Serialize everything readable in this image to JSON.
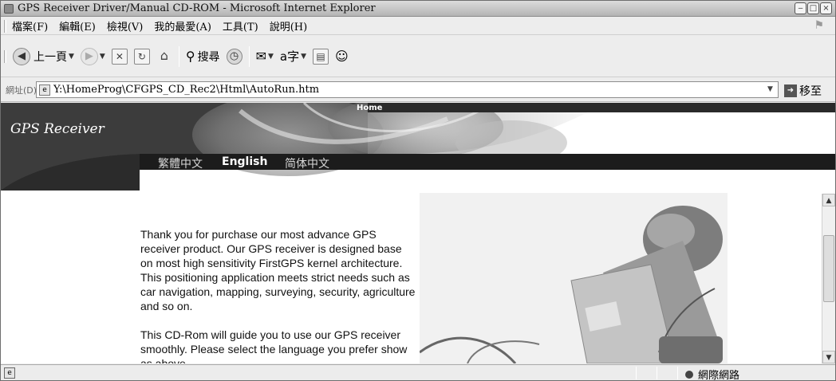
{
  "window": {
    "title": "GPS Receiver Driver/Manual CD-ROM - Microsoft Internet Explorer",
    "buttons": [
      "minimize",
      "maximize",
      "close"
    ]
  },
  "menu": {
    "items": [
      "檔案(F)",
      "編輯(E)",
      "檢視(V)",
      "我的最愛(A)",
      "工具(T)",
      "說明(H)"
    ]
  },
  "toolbar": {
    "back_label": "上一頁",
    "search_label": "搜尋",
    "icons": [
      "back-icon",
      "forward-icon",
      "stop-icon",
      "refresh-icon",
      "home-icon",
      "search-icon",
      "history-icon",
      "mail-icon",
      "text-size-icon",
      "print-icon",
      "messenger-icon"
    ]
  },
  "address": {
    "label": "網址(D)",
    "value": "Y:\\HomeProg\\CFGPS_CD_Rec2\\Html\\AutoRun.htm",
    "go_label": "移至"
  },
  "page": {
    "home_link": "Home",
    "site_title": "GPS Receiver",
    "languages": [
      {
        "label": "繁體中文",
        "active": false
      },
      {
        "label": "English",
        "active": true
      },
      {
        "label": "简体中文",
        "active": false
      }
    ],
    "paragraph1": "Thank you for purchase our most advance GPS receiver product. Our GPS receiver is designed base on most high sensitivity FirstGPS kernel architecture. This positioning application meets strict needs such as car navigation, mapping, surveying, security, agriculture and so on.",
    "paragraph2": "This CD-Rom will guide you to use our GPS receiver smoothly. Please select the language you prefer show as above."
  },
  "status": {
    "zone_label": "網際網路"
  }
}
